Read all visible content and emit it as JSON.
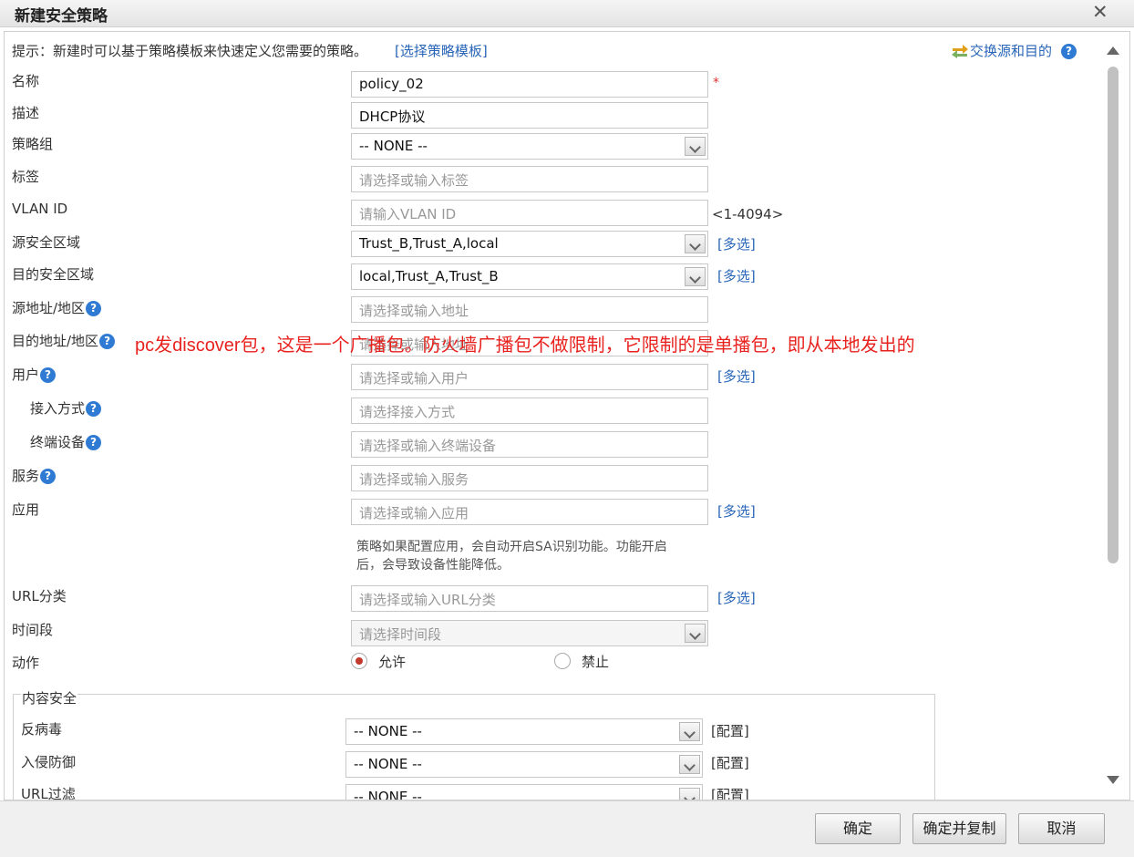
{
  "dialog": {
    "title": "新建安全策略"
  },
  "tip": {
    "text": "提示：新建时可以基于策略模板来快速定义您需要的策略。",
    "template_link": "[选择策略模板]"
  },
  "swap": {
    "label": "交换源和目的"
  },
  "help_glyph": "?",
  "required_mark": "*",
  "form": {
    "name": {
      "label": "名称",
      "value": "policy_02"
    },
    "description": {
      "label": "描述",
      "value": "DHCP协议"
    },
    "policy_group": {
      "label": "策略组",
      "value": "-- NONE --"
    },
    "tag": {
      "label": "标签",
      "placeholder": "请选择或输入标签"
    },
    "vlan": {
      "label": "VLAN ID",
      "placeholder": "请输入VLAN ID",
      "range": "<1-4094>"
    },
    "src_zone": {
      "label": "源安全区域",
      "value": "Trust_B,Trust_A,local",
      "multi": "[多选]"
    },
    "dst_zone": {
      "label": "目的安全区域",
      "value": "local,Trust_A,Trust_B",
      "multi": "[多选]"
    },
    "src_addr": {
      "label": "源地址/地区",
      "placeholder": "请选择或输入地址"
    },
    "dst_addr": {
      "label": "目的地址/地区",
      "placeholder": "请选择或输入地址"
    },
    "user": {
      "label": "用户",
      "placeholder": "请选择或输入用户",
      "multi": "[多选]"
    },
    "access": {
      "label": "接入方式",
      "placeholder": "请选择接入方式"
    },
    "terminal": {
      "label": "终端设备",
      "placeholder": "请选择或输入终端设备"
    },
    "service": {
      "label": "服务",
      "placeholder": "请选择或输入服务"
    },
    "application": {
      "label": "应用",
      "placeholder": "请选择或输入应用",
      "multi": "[多选]",
      "hint_line1": "策略如果配置应用，会自动开启SA识别功能。功能开启",
      "hint_line2": "后，会导致设备性能降低。"
    },
    "url_category": {
      "label": "URL分类",
      "placeholder": "请选择或输入URL分类",
      "multi": "[多选]"
    },
    "time_range": {
      "label": "时间段",
      "placeholder": "请选择时间段"
    },
    "action": {
      "label": "动作",
      "options": [
        "允许",
        "禁止"
      ],
      "selected": "允许"
    }
  },
  "content_security": {
    "legend": "内容安全",
    "rows": [
      {
        "label": "反病毒",
        "value": "-- NONE --",
        "config": "[配置]"
      },
      {
        "label": "入侵防御",
        "value": "-- NONE --",
        "config": "[配置]"
      },
      {
        "label": "URL过滤",
        "value": "-- NONE --",
        "config": "[配置]"
      }
    ]
  },
  "annotation": "pc发discover包，这是一个广播包。防火墙广播包不做限制，它限制的是单播包，即从本地发出的",
  "buttons": {
    "ok": "确定",
    "ok_copy": "确定并复制",
    "cancel": "取消"
  }
}
